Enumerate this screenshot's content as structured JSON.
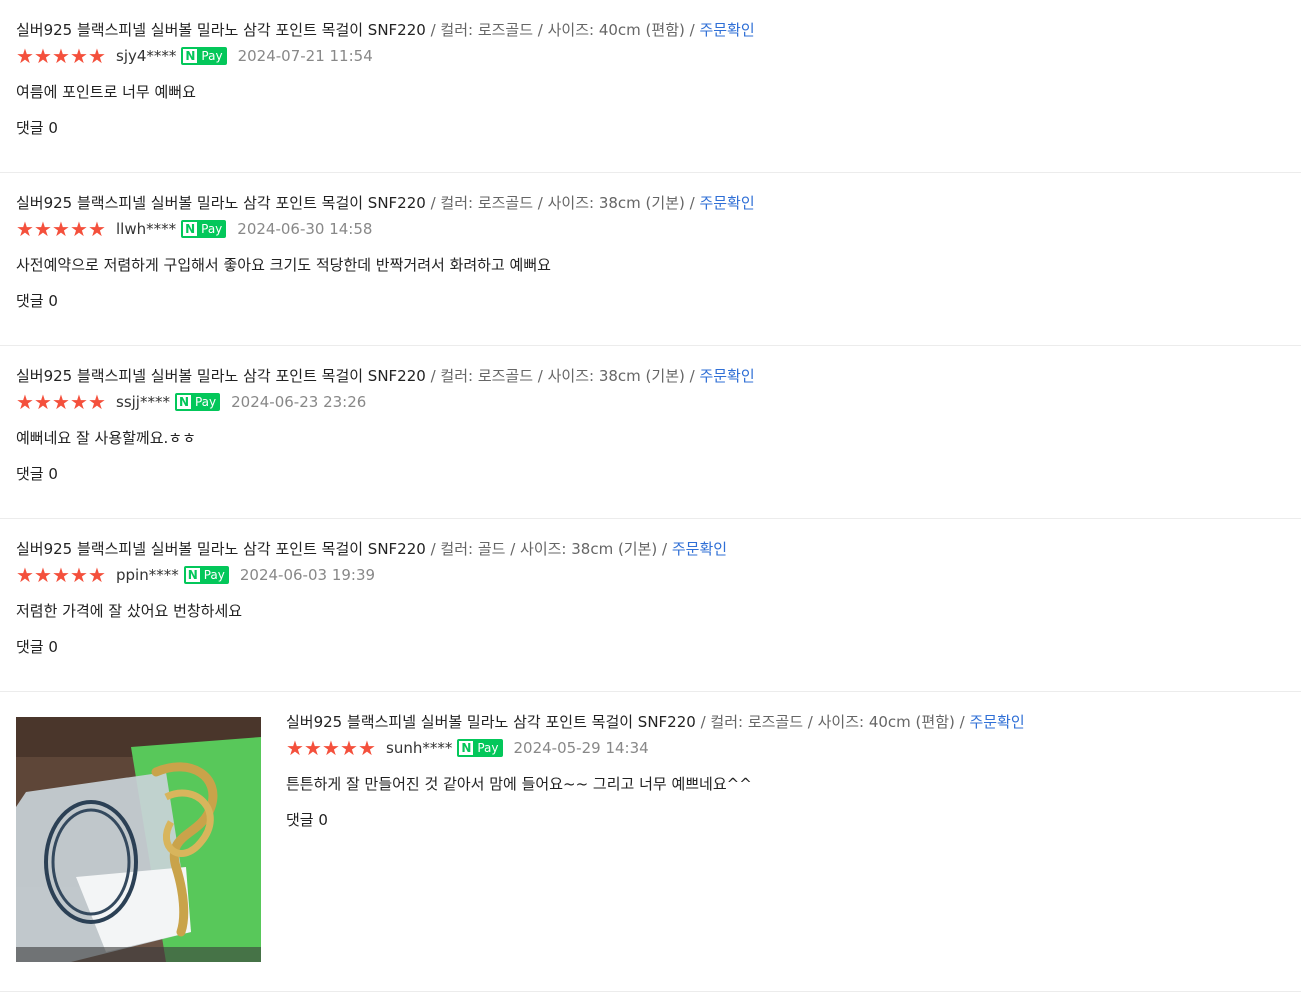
{
  "reviews": [
    {
      "product": "실버925 블랙스피넬 실버볼 밀라노 삼각 포인트 목걸이 SNF220",
      "option": " / 컬러: 로즈골드 / 사이즈: 40cm (편함) / ",
      "order_link": "주문확인",
      "rating": 5,
      "user": "sjy4****",
      "npay_n": "N",
      "npay_label": "Pay",
      "date": "2024-07-21 11:54",
      "text": "여름에 포인트로 너무 예뻐요",
      "comments": "댓글 0"
    },
    {
      "product": "실버925 블랙스피넬 실버볼 밀라노 삼각 포인트 목걸이 SNF220",
      "option": " / 컬러: 로즈골드 / 사이즈: 38cm (기본) / ",
      "order_link": "주문확인",
      "rating": 5,
      "user": "llwh****",
      "npay_n": "N",
      "npay_label": "Pay",
      "date": "2024-06-30 14:58",
      "text": "사전예약으로 저렴하게 구입해서 좋아요 크기도 적당한데 반짝거려서 화려하고 예뻐요",
      "comments": "댓글 0"
    },
    {
      "product": "실버925 블랙스피넬 실버볼 밀라노 삼각 포인트 목걸이 SNF220",
      "option": " / 컬러: 로즈골드 / 사이즈: 38cm (기본) / ",
      "order_link": "주문확인",
      "rating": 5,
      "user": "ssjj****",
      "npay_n": "N",
      "npay_label": "Pay",
      "date": "2024-06-23 23:26",
      "text": "예뻐네요 잘 사용할께요.ㅎㅎ",
      "comments": "댓글 0"
    },
    {
      "product": "실버925 블랙스피넬 실버볼 밀라노 삼각 포인트 목걸이 SNF220",
      "option": " / 컬러: 골드 / 사이즈: 38cm (기본) / ",
      "order_link": "주문확인",
      "rating": 5,
      "user": "ppin****",
      "npay_n": "N",
      "npay_label": "Pay",
      "date": "2024-06-03 19:39",
      "text": "저렴한 가격에 잘 샀어요 번창하세요",
      "comments": "댓글 0"
    },
    {
      "product": "실버925 블랙스피넬 실버볼 밀라노 삼각 포인트 목걸이 SNF220",
      "option": " / 컬러: 로즈골드 / 사이즈: 40cm (편함) / ",
      "order_link": "주문확인",
      "rating": 5,
      "user": "sunh****",
      "npay_n": "N",
      "npay_label": "Pay",
      "date": "2024-05-29 14:34",
      "text": "튼튼하게 잘 만들어진 것 같아서 맘에 들어요~~ 그리고 너무 예쁘네요^^",
      "comments": "댓글 0",
      "has_photo": true
    }
  ],
  "colors": {
    "star": "#f4503c",
    "npay": "#03c75a",
    "link": "#2f6fd6",
    "muted": "#888888"
  }
}
